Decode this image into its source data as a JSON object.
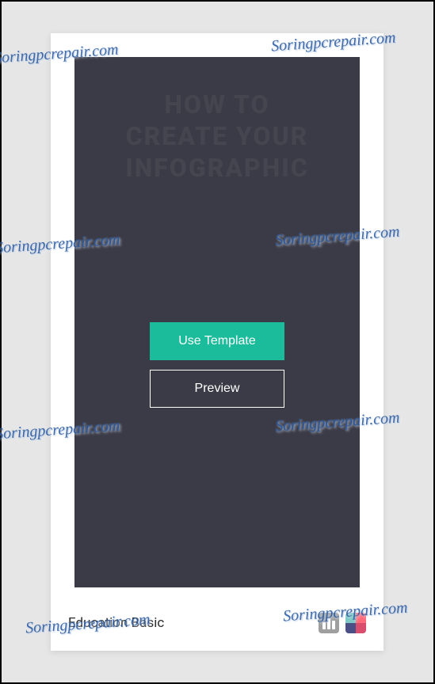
{
  "template": {
    "title": "Education Basic",
    "heading": "HOW TO\nCREATE YOUR\nINFOGRAPHIC"
  },
  "buttons": {
    "use_template": "Use Template",
    "preview": "Preview"
  },
  "watermark": "Soringpcrepair.com"
}
